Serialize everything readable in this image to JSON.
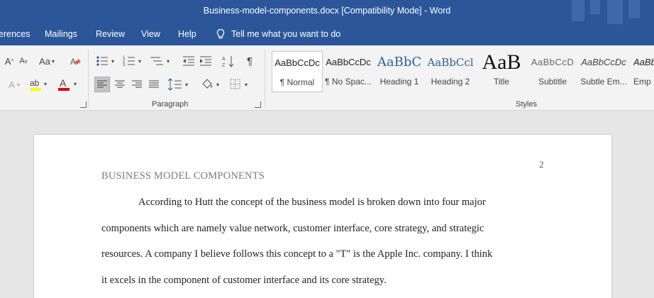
{
  "window": {
    "title": "Business-model-components.docx [Compatibility Mode]  -  Word"
  },
  "tabs": [
    {
      "label": "erences"
    },
    {
      "label": "Mailings"
    },
    {
      "label": "Review"
    },
    {
      "label": "View"
    },
    {
      "label": "Help"
    }
  ],
  "tell_me": {
    "label": "Tell me what you want to do",
    "icon": "lightbulb-icon"
  },
  "ribbon": {
    "paragraph_label": "Paragraph",
    "styles_label": "Styles",
    "case_glyph": "Aa",
    "styles": [
      {
        "sample": "AaBbCcDc",
        "name": "¶ Normal"
      },
      {
        "sample": "AaBbCcDc",
        "name": "¶ No Spac..."
      },
      {
        "sample": "AaBbC",
        "name": "Heading 1"
      },
      {
        "sample": "AaBbCcl",
        "name": "Heading 2"
      },
      {
        "sample": "AaB",
        "name": "Title"
      },
      {
        "sample": "AaBbCcD",
        "name": "Subtitle"
      },
      {
        "sample": "AaBbCcDc",
        "name": "Subtle Em..."
      },
      {
        "sample": "AaBb",
        "name": "Emp"
      }
    ],
    "colors": {
      "highlight": "#ffff00",
      "font_color": "#e00000"
    }
  },
  "document": {
    "page_number": "2",
    "running_head": "BUSINESS MODEL COMPONENTS",
    "lines": [
      "According to Hutt the concept of the business model is broken down into four major",
      "components which are namely value network, customer interface, core strategy, and strategic",
      "resources. A company I believe follows this concept to a \"T\" is the Apple Inc. company. I think",
      "it excels in the component of customer interface and its core strategy."
    ]
  }
}
